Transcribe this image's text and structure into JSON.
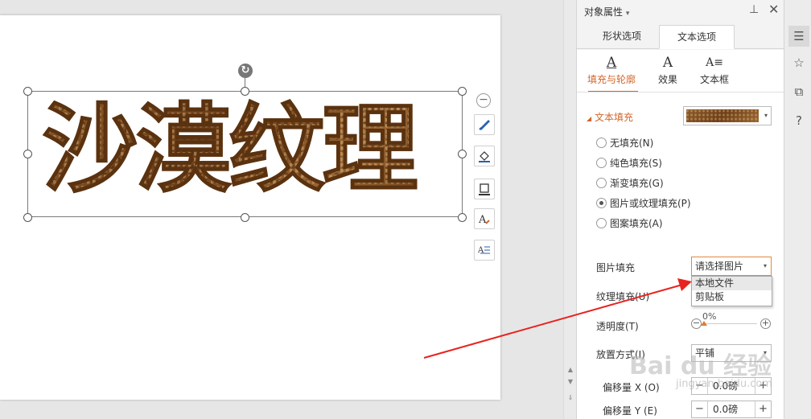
{
  "canvas": {
    "art_text": "沙漠纹理"
  },
  "panel": {
    "title": "对象属性",
    "title_arrow": "▾",
    "tabs": [
      {
        "label": "形状选项"
      },
      {
        "label": "文本选项"
      }
    ],
    "subtabs": [
      {
        "label": "填充与轮廓",
        "icon": "A"
      },
      {
        "label": "效果",
        "icon": "A"
      },
      {
        "label": "文本框",
        "icon": "A≡"
      }
    ],
    "section": {
      "toggle": "◢",
      "title": "文本填充"
    },
    "fill_options": [
      {
        "label": "无填充(N)",
        "selected": false
      },
      {
        "label": "纯色填充(S)",
        "selected": false
      },
      {
        "label": "渐变填充(G)",
        "selected": false
      },
      {
        "label": "图片或纹理填充(P)",
        "selected": true
      },
      {
        "label": "图案填充(A)",
        "selected": false
      }
    ],
    "picture_fill": {
      "label": "图片填充",
      "value": "请选择图片",
      "dropdown": [
        "本地文件",
        "剪贴板"
      ]
    },
    "texture_fill": {
      "label": "纹理填充(U)"
    },
    "opacity": {
      "label": "透明度(T)",
      "value": "0%",
      "level": 0
    },
    "placement": {
      "label": "放置方式(I)",
      "value": "平铺"
    },
    "offset_x": {
      "label": "偏移量 X (O)",
      "value": "0.0磅"
    },
    "offset_y": {
      "label": "偏移量 Y (E)",
      "value": "0.0磅"
    }
  },
  "watermark": {
    "text": "Bai du 经验",
    "sub": "jingyan.baidu.com"
  },
  "colors": {
    "accent": "#d2662a",
    "arrow": "#e8231f",
    "texture": "#7a4a22"
  }
}
